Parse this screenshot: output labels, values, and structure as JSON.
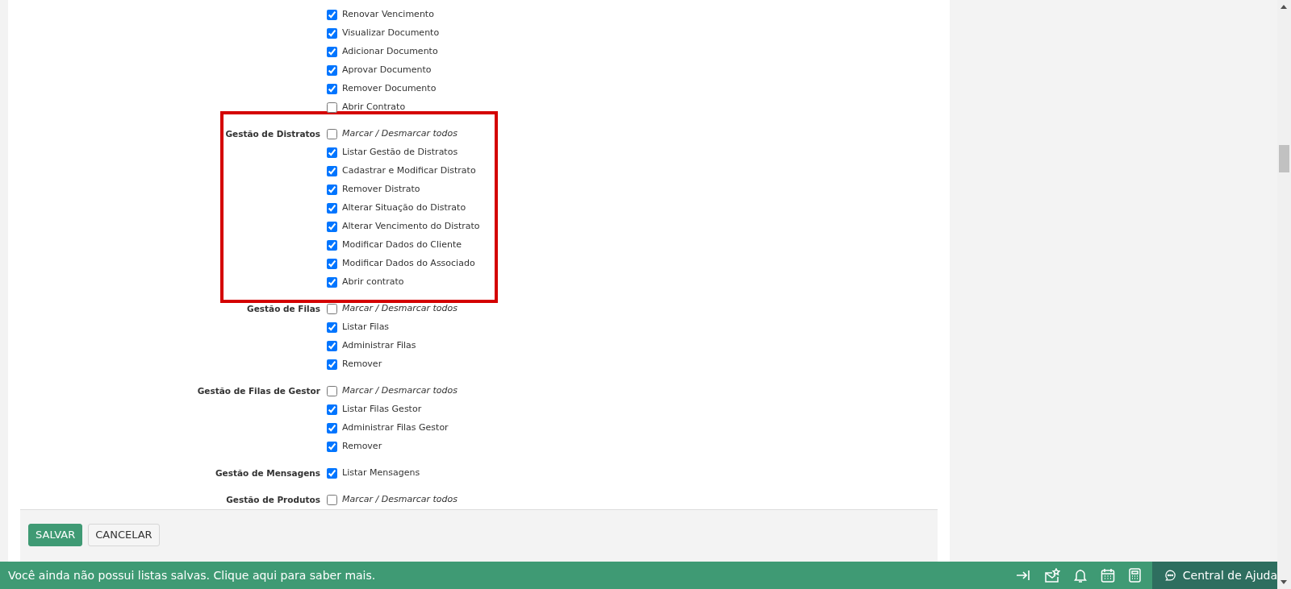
{
  "groups": [
    {
      "highlighted": false,
      "items": [
        {
          "kind": "permission",
          "label": "Renovar Vencimento",
          "checked": true
        },
        {
          "kind": "permission",
          "label": "Visualizar Documento",
          "checked": true
        },
        {
          "kind": "permission",
          "label": "Adicionar Documento",
          "checked": true
        },
        {
          "kind": "permission",
          "label": "Aprovar Documento",
          "checked": true
        },
        {
          "kind": "permission",
          "label": "Remover Documento",
          "checked": true
        },
        {
          "kind": "permission",
          "label": "Abrir Contrato",
          "checked": false
        }
      ]
    },
    {
      "label": "Gestão de Distratos",
      "highlighted": true,
      "items": [
        {
          "kind": "toggle_all",
          "label": "Marcar / Desmarcar todos",
          "checked": false
        },
        {
          "kind": "permission",
          "label": "Listar Gestão de Distratos",
          "checked": true
        },
        {
          "kind": "permission",
          "label": "Cadastrar e Modificar Distrato",
          "checked": true
        },
        {
          "kind": "permission",
          "label": "Remover Distrato",
          "checked": true
        },
        {
          "kind": "permission",
          "label": "Alterar Situação do Distrato",
          "checked": true
        },
        {
          "kind": "permission",
          "label": "Alterar Vencimento do Distrato",
          "checked": true
        },
        {
          "kind": "permission",
          "label": "Modificar Dados do Cliente",
          "checked": true
        },
        {
          "kind": "permission",
          "label": "Modificar Dados do Associado",
          "checked": true
        },
        {
          "kind": "permission",
          "label": "Abrir contrato",
          "checked": true
        }
      ]
    },
    {
      "label": "Gestão de Filas",
      "highlighted": false,
      "items": [
        {
          "kind": "toggle_all",
          "label": "Marcar / Desmarcar todos",
          "checked": false
        },
        {
          "kind": "permission",
          "label": "Listar Filas",
          "checked": true
        },
        {
          "kind": "permission",
          "label": "Administrar Filas",
          "checked": true
        },
        {
          "kind": "permission",
          "label": "Remover",
          "checked": true
        }
      ]
    },
    {
      "label": "Gestão de Filas de Gestor",
      "highlighted": false,
      "items": [
        {
          "kind": "toggle_all",
          "label": "Marcar / Desmarcar todos",
          "checked": false
        },
        {
          "kind": "permission",
          "label": "Listar Filas Gestor",
          "checked": true
        },
        {
          "kind": "permission",
          "label": "Administrar Filas Gestor",
          "checked": true
        },
        {
          "kind": "permission",
          "label": "Remover",
          "checked": true
        }
      ]
    },
    {
      "label": "Gestão de Mensagens",
      "highlighted": false,
      "items": [
        {
          "kind": "permission",
          "label": "Listar Mensagens",
          "checked": true
        }
      ]
    },
    {
      "label": "Gestão de Produtos",
      "highlighted": false,
      "items": [
        {
          "kind": "toggle_all",
          "label": "Marcar / Desmarcar todos",
          "checked": false
        }
      ]
    }
  ],
  "buttons": [
    {
      "kind": "primary",
      "label": "SALVAR"
    },
    {
      "kind": "secondary",
      "label": "CANCELAR"
    }
  ],
  "status_bar": {
    "message": "Você ainda não possui listas salvas. Clique aqui para saber mais.",
    "help": "Central de Ajuda"
  }
}
